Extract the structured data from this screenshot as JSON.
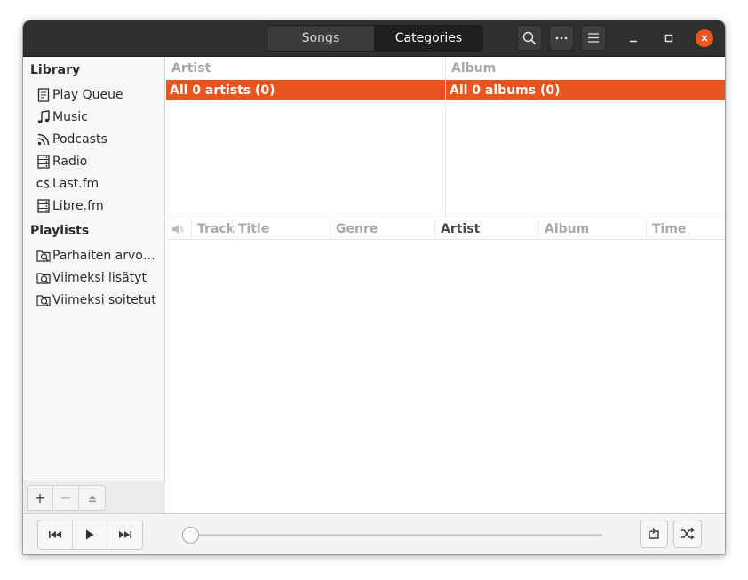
{
  "header": {
    "tabs": [
      {
        "label": "Songs",
        "active": false
      },
      {
        "label": "Categories",
        "active": true
      }
    ],
    "icons": [
      "search-icon",
      "more-icon",
      "menu-icon",
      "minimize-icon",
      "maximize-icon",
      "close-icon"
    ]
  },
  "sidebar": {
    "library_heading": "Library",
    "library_items": [
      {
        "label": "Play Queue",
        "icon": "queue-icon"
      },
      {
        "label": "Music",
        "icon": "music-note-icon"
      },
      {
        "label": "Podcasts",
        "icon": "rss-icon"
      },
      {
        "label": "Radio",
        "icon": "radio-icon"
      },
      {
        "label": "Last.fm",
        "icon": "lastfm-icon"
      },
      {
        "label": "Libre.fm",
        "icon": "librefm-icon"
      }
    ],
    "playlists_heading": "Playlists",
    "playlist_items": [
      {
        "label": "Parhaiten arvostellut",
        "icon": "smart-playlist-icon"
      },
      {
        "label": "Viimeksi lisätyt",
        "icon": "smart-playlist-icon"
      },
      {
        "label": "Viimeksi soitetut",
        "icon": "smart-playlist-icon"
      }
    ],
    "toolbar": {
      "add": "+",
      "remove": "−"
    }
  },
  "browser": {
    "artist_header": "Artist",
    "album_header": "Album",
    "artist_selected": "All 0 artists (0)",
    "album_selected": "All 0 albums (0)",
    "accent_color": "#e95420"
  },
  "tracklist": {
    "columns": [
      "Track",
      "Title",
      "Genre",
      "Artist",
      "Album",
      "Time"
    ],
    "sorted_column": "Artist",
    "rows": []
  },
  "player": {
    "position": 0
  }
}
